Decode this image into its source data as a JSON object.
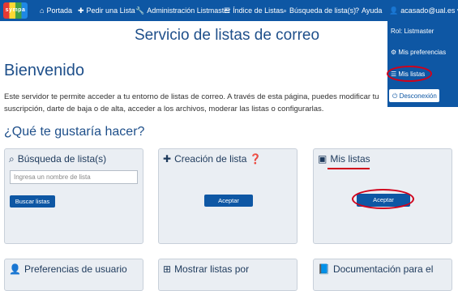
{
  "nav": {
    "items": [
      {
        "icon": "home-icon",
        "label": "Portada"
      },
      {
        "icon": "plus-icon",
        "label": "Pedir una Lista"
      },
      {
        "icon": "wrench-icon",
        "label": "Administración Listmaster"
      },
      {
        "icon": "list-icon",
        "label": "Índice de Listas"
      },
      {
        "icon": "search-icon",
        "label": "Búsqueda de lista(s)"
      },
      {
        "icon": "help-icon",
        "label": "Ayuda"
      },
      {
        "icon": "user-icon",
        "label": "acasado@ual.es"
      }
    ],
    "logo_text": "sympa"
  },
  "dropdown": {
    "role": "Rol: Listmaster",
    "preferences": "Mis preferencias",
    "my_lists": "Mis listas",
    "logout": "Desconexión"
  },
  "page": {
    "title": "Servicio de listas de correo",
    "welcome": "Bienvenido",
    "intro": "Este servidor te permite acceder a tu entorno de listas de correo. A través de esta página, puedes modificar tu suscripción, darte de baja o de alta, acceder a los archivos, moderar las listas o configurarlas.",
    "question": "¿Qué te gustaría hacer?"
  },
  "cards": {
    "search": {
      "title": "Búsqueda de lista(s)",
      "placeholder": "Ingresa un nombre de lista",
      "button": "Buscar listas"
    },
    "create": {
      "title": "Creación de lista",
      "button": "Aceptar"
    },
    "mylists": {
      "title": "Mis listas",
      "button": "Aceptar"
    },
    "prefs": {
      "title": "Preferencias de usuario"
    },
    "show": {
      "title": "Mostrar listas por"
    },
    "docs": {
      "title": "Documentación para el"
    }
  },
  "colors": {
    "primary": "#0e57a4",
    "annotation": "#d0021b",
    "heading": "#1e4f8a"
  }
}
